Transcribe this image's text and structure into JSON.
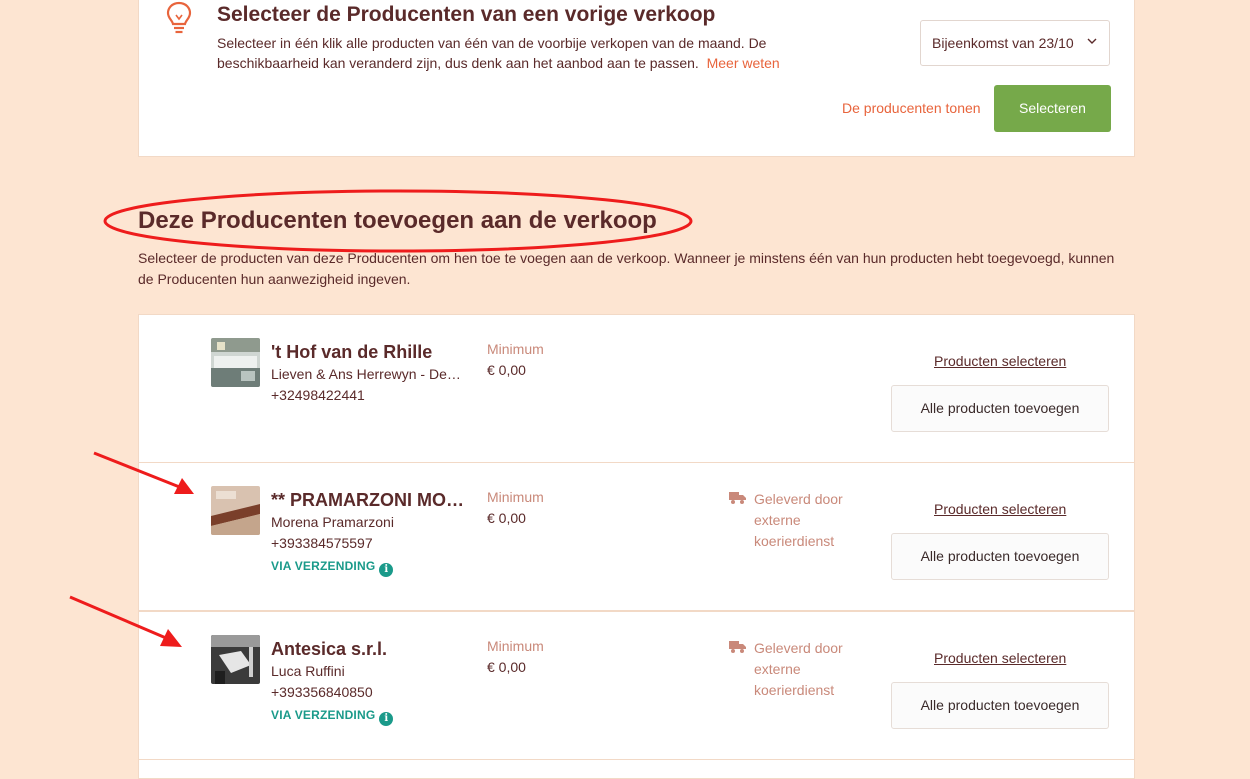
{
  "previous_sale": {
    "title": "Selecteer de Producenten van een vorige verkoop",
    "description": "Selecteer in één klik alle producten van één van de voorbije verkopen van de maand. De beschikbaarheid kan veranderd zijn, dus denk aan het aanbod aan te passen.",
    "learn_more": "Meer weten",
    "selected_sale": "Bijeenkomst van 23/10",
    "show_producers": "De producenten tonen",
    "select_button": "Selecteren",
    "icon": "lightbulb-icon"
  },
  "add_section": {
    "title": "Deze Producenten toevoegen aan de verkoop",
    "description": "Selecteer de producten van deze Producenten om hen toe te voegen aan de verkoop. Wanneer je minstens één van hun producten hebt toegevoegd, kunnen de Producenten hun aanwezigheid ingeven."
  },
  "producers": [
    {
      "name": "'t Hof van de Rhille",
      "contact": "Lieven & Ans Herrewyn - De Rhille",
      "phone": "+32498422441",
      "minimum_label": "Minimum",
      "minimum_value": "€ 0,00",
      "via": "",
      "delivery": "",
      "select_link": "Producten selecteren",
      "add_all": "Alle producten toevoegen"
    },
    {
      "name": "** PRAMARZONI MONTAGNE",
      "contact": "Morena Pramarzoni",
      "phone": "+393384575597",
      "minimum_label": "Minimum",
      "minimum_value": "€ 0,00",
      "via": "VIA VERZENDING",
      "delivery": "Geleverd door externe koerierdienst",
      "select_link": "Producten selecteren",
      "add_all": "Alle producten toevoegen"
    },
    {
      "name": "Antesica s.r.l.",
      "contact": "Luca Ruffini",
      "phone": "+393356840850",
      "minimum_label": "Minimum",
      "minimum_value": "€ 0,00",
      "via": "VIA VERZENDING",
      "delivery": "Geleverd door externe koerierdienst",
      "select_link": "Producten selecteren",
      "add_all": "Alle producten toevoegen"
    }
  ],
  "colors": {
    "background": "#fde5d2",
    "accent_orange": "#e8643c",
    "button_green": "#76a94a",
    "text_brown": "#5a2a2a",
    "muted": "#c9897a",
    "teal": "#1a9a8a",
    "annotation_red": "#ee1c1c"
  }
}
